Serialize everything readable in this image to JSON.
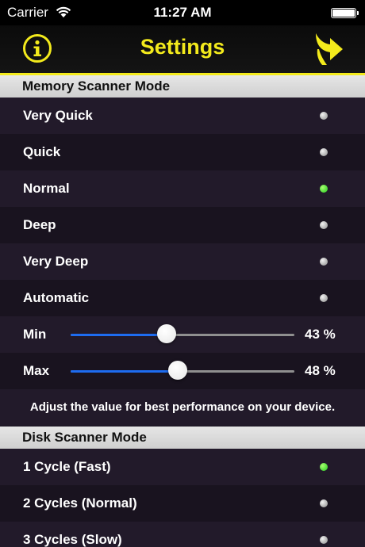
{
  "status_bar": {
    "carrier": "Carrier",
    "time": "11:27 AM",
    "battery_level": 1.0
  },
  "nav": {
    "title": "Settings",
    "info_icon": "info-icon",
    "next_icon": "curved-arrow-icon",
    "accent_color": "#f3ea1c"
  },
  "memory": {
    "header": "Memory Scanner Mode",
    "options": [
      {
        "label": "Very Quick",
        "selected": false
      },
      {
        "label": "Quick",
        "selected": false
      },
      {
        "label": "Normal",
        "selected": true
      },
      {
        "label": "Deep",
        "selected": false
      },
      {
        "label": "Very Deep",
        "selected": false
      },
      {
        "label": "Automatic",
        "selected": false
      }
    ],
    "min": {
      "label": "Min",
      "value": 43,
      "display": "43 %"
    },
    "max": {
      "label": "Max",
      "value": 48,
      "display": "48 %"
    },
    "hint": "Adjust the value for best performance on your device."
  },
  "disk": {
    "header": "Disk Scanner Mode",
    "options": [
      {
        "label": "1 Cycle (Fast)",
        "selected": true
      },
      {
        "label": "2 Cycles (Normal)",
        "selected": false
      },
      {
        "label": "3 Cycles (Slow)",
        "selected": false
      }
    ]
  },
  "colors": {
    "selected_dot": "#22c81e",
    "unselected_dot": "#bdbdbd",
    "slider_fill": "#1e6cf0"
  }
}
